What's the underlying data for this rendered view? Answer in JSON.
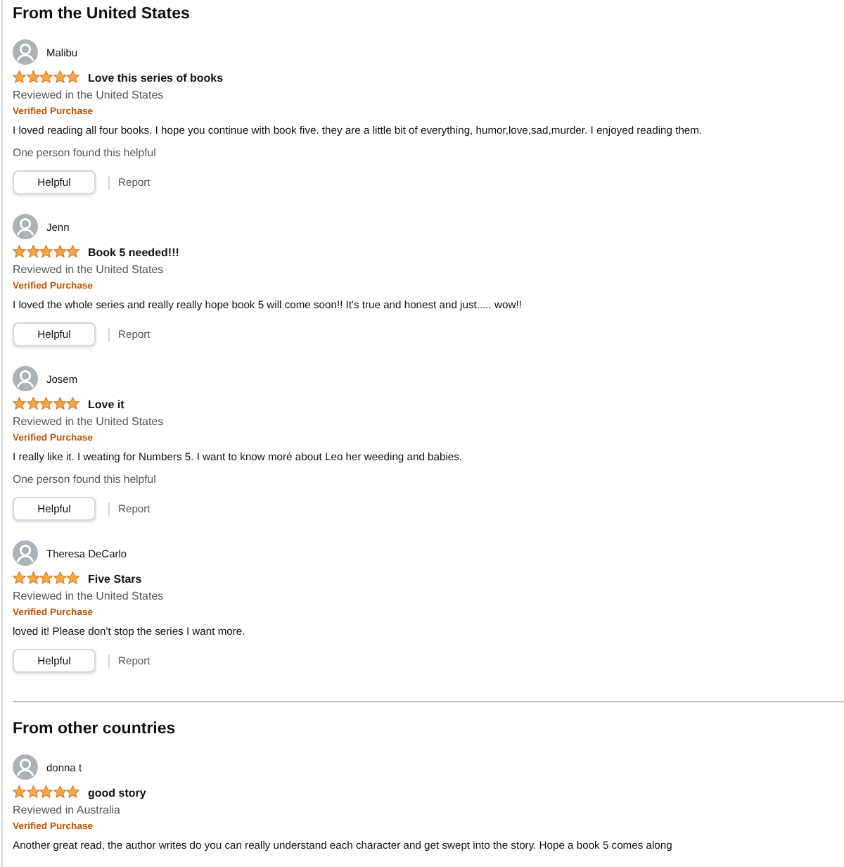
{
  "sections": [
    {
      "title": "From the United States",
      "reviews": [
        {
          "author": "Malibu",
          "stars": 5,
          "title": "Love this series of books",
          "location": "Reviewed in the United States",
          "badge": "Verified Purchase",
          "body": "I loved reading all four books. I hope you continue with book five. they are a little bit of everything, humor,love,sad,murder. I enjoyed reading them.",
          "helpful_count": "One person found this helpful",
          "helpful_button": "Helpful",
          "report_link": "Report"
        },
        {
          "author": "Jenn",
          "stars": 5,
          "title": "Book 5 needed!!!",
          "location": "Reviewed in the United States",
          "badge": "Verified Purchase",
          "body": "I loved the whole series and really really hope book 5 will come soon!! It's true and honest and just..... wow!!",
          "helpful_button": "Helpful",
          "report_link": "Report"
        },
        {
          "author": "Josem",
          "stars": 5,
          "title": "Love it",
          "location": "Reviewed in the United States",
          "badge": "Verified Purchase",
          "body": "I really like it. I weating for Numbers 5. I want to know moré about Leo her weeding and babies.",
          "helpful_count": "One person found this helpful",
          "helpful_button": "Helpful",
          "report_link": "Report"
        },
        {
          "author": "Theresa DeCarlo",
          "stars": 5,
          "title": "Five Stars",
          "location": "Reviewed in the United States",
          "badge": "Verified Purchase",
          "body": "loved it! Please don't stop the series I want more.",
          "helpful_button": "Helpful",
          "report_link": "Report"
        }
      ]
    },
    {
      "title": "From other countries",
      "reviews": [
        {
          "author": "donna t",
          "stars": 5,
          "title": "good story",
          "location": "Reviewed in Australia",
          "badge": "Verified Purchase",
          "body": "Another great read, the author writes do you can really understand each character and get swept into the story. Hope a book 5 comes along"
        }
      ]
    }
  ]
}
